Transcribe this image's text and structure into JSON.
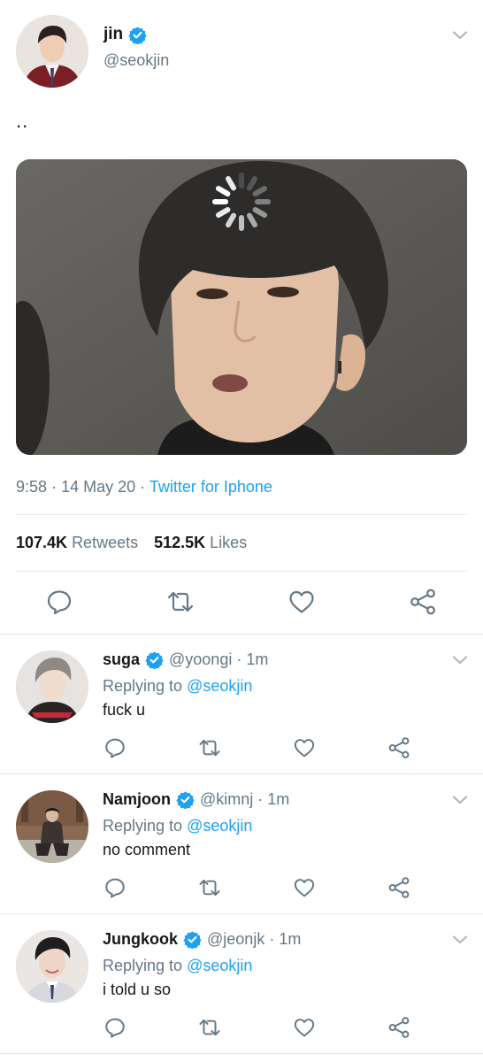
{
  "tweet": {
    "display_name": "jin",
    "handle": "@seokjin",
    "verified": true,
    "text": "..",
    "time": "9:58",
    "date": "14 May 20",
    "source": "Twitter for Iphone",
    "retweets_count": "107.4K",
    "retweets_label": "Retweets",
    "likes_count": "512.5K",
    "likes_label": "Likes"
  },
  "replies": [
    {
      "display_name": "suga",
      "handle": "@yoongi",
      "time": "1m",
      "replying_label": "Replying to",
      "replying_to": "@seokjin",
      "text": "fuck u"
    },
    {
      "display_name": "Namjoon",
      "handle": "@kimnj",
      "time": "1m",
      "replying_label": "Replying to",
      "replying_to": "@seokjin",
      "text": "no comment"
    },
    {
      "display_name": "Jungkook",
      "handle": "@jeonjk",
      "time": "1m",
      "replying_label": "Replying to",
      "replying_to": "@seokjin",
      "text": "i told u so"
    }
  ],
  "separator": "·",
  "icons": {
    "verified": "verified-badge-icon",
    "chevron": "chevron-down-icon",
    "reply": "reply-icon",
    "retweet": "retweet-icon",
    "like": "heart-icon",
    "share": "share-icon",
    "loading": "loading-spinner-icon"
  },
  "colors": {
    "accent": "#1da1f2",
    "text": "#14171a",
    "secondary": "#657786",
    "divider": "#e1e8ed"
  }
}
